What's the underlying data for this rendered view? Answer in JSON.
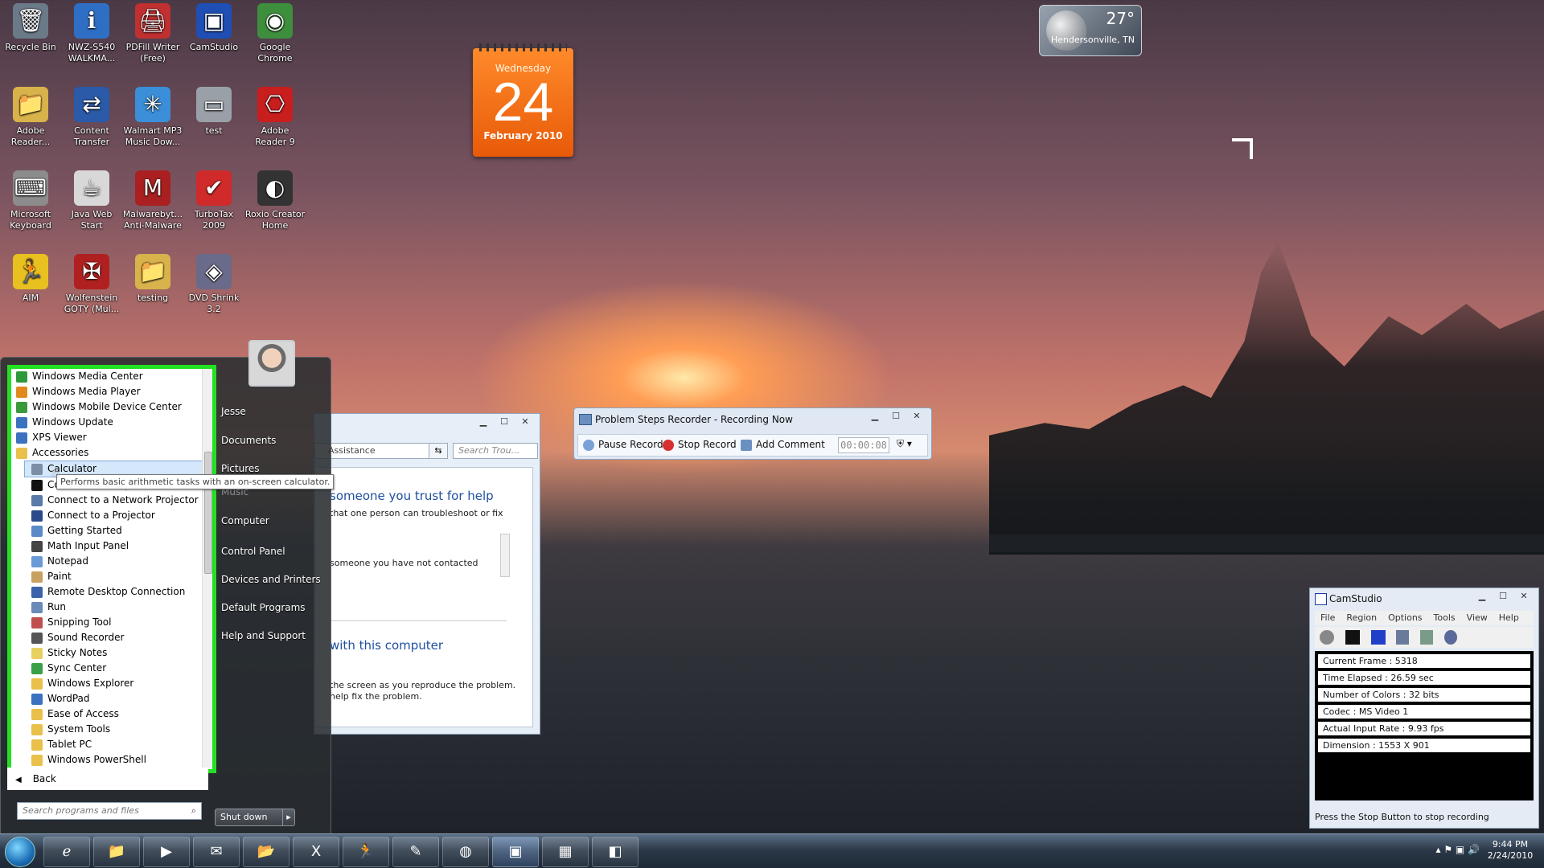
{
  "desktop": {
    "icons": [
      {
        "label": "Recycle Bin",
        "glyph": "🗑"
      },
      {
        "label": "NWZ-S540 WALKMA...",
        "glyph": "ℹ"
      },
      {
        "label": "PDFill Writer (Free)",
        "glyph": "🖨"
      },
      {
        "label": "CamStudio",
        "glyph": "▣"
      },
      {
        "label": "Google Chrome",
        "glyph": "◉"
      },
      {
        "label": "Adobe Reader...",
        "glyph": "📁"
      },
      {
        "label": "Content Transfer",
        "glyph": "⇄"
      },
      {
        "label": "Walmart MP3 Music Dow...",
        "glyph": "✳"
      },
      {
        "label": "test",
        "glyph": "▭"
      },
      {
        "label": "Adobe Reader 9",
        "glyph": "⎔"
      },
      {
        "label": "Microsoft Keyboard",
        "glyph": "⌨"
      },
      {
        "label": "Java Web Start",
        "glyph": "☕"
      },
      {
        "label": "Malwarebyt... Anti-Malware",
        "glyph": "M"
      },
      {
        "label": "TurboTax 2009",
        "glyph": "✔"
      },
      {
        "label": "Roxio Creator Home",
        "glyph": "◐"
      },
      {
        "label": "AIM",
        "glyph": "🏃"
      },
      {
        "label": "Wolfenstein GOTY (Mul...",
        "glyph": "✠"
      },
      {
        "label": "testing",
        "glyph": "📁"
      },
      {
        "label": "DVD Shrink 3.2",
        "glyph": "◈"
      }
    ]
  },
  "calendar": {
    "weekday": "Wednesday",
    "day": "24",
    "month_year": "February 2010"
  },
  "weather": {
    "temperature": "27°",
    "location": "Hendersonville, TN"
  },
  "start_menu": {
    "programs": [
      {
        "label": "Windows Media Center",
        "level": "top",
        "color": "#2c9a3a"
      },
      {
        "label": "Windows Media Player",
        "level": "top",
        "color": "#e08a1e"
      },
      {
        "label": "Windows Mobile Device Center",
        "level": "top",
        "color": "#3a9a3a"
      },
      {
        "label": "Windows Update",
        "level": "top",
        "color": "#3a72c0"
      },
      {
        "label": "XPS Viewer",
        "level": "top",
        "color": "#3a72c0"
      },
      {
        "label": "Accessories",
        "level": "top",
        "color": "#e8c04a"
      },
      {
        "label": "Calculator",
        "level": "sel",
        "color": "#7a8ea8"
      },
      {
        "label": "Command Prompt",
        "level": "sub",
        "color": "#111111"
      },
      {
        "label": "Connect to a Network Projector",
        "level": "sub",
        "color": "#5a7aa8"
      },
      {
        "label": "Connect to a Projector",
        "level": "sub",
        "color": "#2a4a8a"
      },
      {
        "label": "Getting Started",
        "level": "sub",
        "color": "#5a8ac8"
      },
      {
        "label": "Math Input Panel",
        "level": "sub",
        "color": "#444444"
      },
      {
        "label": "Notepad",
        "level": "sub",
        "color": "#6a9ad8"
      },
      {
        "label": "Paint",
        "level": "sub",
        "color": "#c8a060"
      },
      {
        "label": "Remote Desktop Connection",
        "level": "sub",
        "color": "#3a62a8"
      },
      {
        "label": "Run",
        "level": "sub",
        "color": "#6a8ab8"
      },
      {
        "label": "Snipping Tool",
        "level": "sub",
        "color": "#c05050"
      },
      {
        "label": "Sound Recorder",
        "level": "sub",
        "color": "#555555"
      },
      {
        "label": "Sticky Notes",
        "level": "sub",
        "color": "#e8d060"
      },
      {
        "label": "Sync Center",
        "level": "sub",
        "color": "#3aa048"
      },
      {
        "label": "Windows Explorer",
        "level": "sub",
        "color": "#e8c04a"
      },
      {
        "label": "WordPad",
        "level": "sub",
        "color": "#3a72c0"
      },
      {
        "label": "Ease of Access",
        "level": "sub",
        "color": "#e8c04a"
      },
      {
        "label": "System Tools",
        "level": "sub",
        "color": "#e8c04a"
      },
      {
        "label": "Tablet PC",
        "level": "sub",
        "color": "#e8c04a"
      },
      {
        "label": "Windows PowerShell",
        "level": "sub",
        "color": "#e8c04a"
      }
    ],
    "back_label": "Back",
    "search_placeholder": "Search programs and files",
    "user_name": "Jesse",
    "right_items": [
      "Documents",
      "Pictures",
      "Music",
      "Computer",
      "Control Panel",
      "Devices and Printers",
      "Default Programs",
      "Help and Support"
    ],
    "shutdown_label": "Shut down",
    "tooltip": "Performs basic arithmetic tasks with an on-screen calculator."
  },
  "help_window": {
    "address": "Assistance",
    "search_placeholder": "Search Trou...",
    "heading1": "someone you trust for help",
    "line1": "that one person can troubleshoot or fix",
    "line2": "someone you have not contacted",
    "heading2": "with this computer",
    "line3": "the screen as you reproduce the problem.",
    "line4": "help fix the problem."
  },
  "psr": {
    "title": "Problem Steps Recorder - Recording Now",
    "pause_label": "Pause Record",
    "stop_label": "Stop Record",
    "comment_label": "Add Comment",
    "timer": "00:00:08"
  },
  "camstudio": {
    "title": "CamStudio",
    "menu": [
      "File",
      "Region",
      "Options",
      "Tools",
      "View",
      "Help"
    ],
    "stats": [
      "Current Frame : 5318",
      "Time Elapsed : 26.59 sec",
      "Number of Colors : 32 bits",
      "Codec : MS Video 1",
      "Actual Input Rate : 9.93 fps",
      "Dimension : 1553 X 901"
    ],
    "status": "Press the Stop Button to stop recording"
  },
  "taskbar": {
    "apps": [
      "internet-explorer",
      "windows-explorer",
      "media-player",
      "outlook",
      "folder",
      "excel",
      "aim",
      "notepad",
      "web-browser",
      "camstudio",
      "remote-desktop",
      "problem-steps-recorder"
    ],
    "time": "9:44 PM",
    "date": "2/24/2010"
  },
  "colors": {
    "highlight_border": "#22e022",
    "calendar": "#f07020"
  }
}
